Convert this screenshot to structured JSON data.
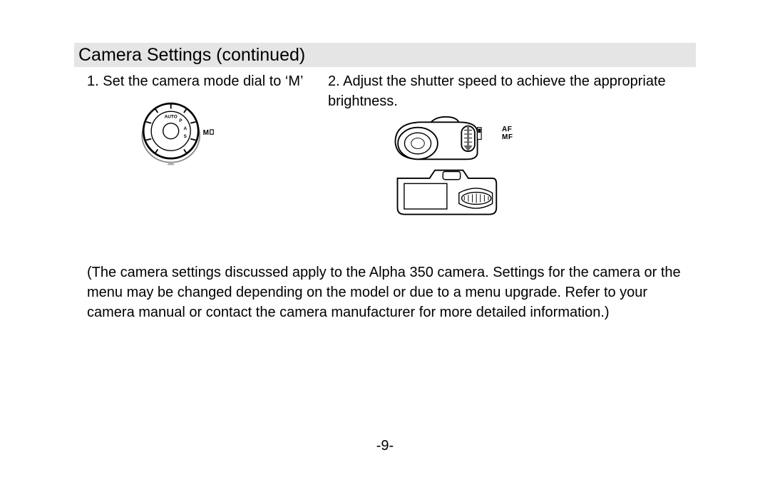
{
  "heading": "Camera Settings (continued)",
  "step1": {
    "text": "1. Set the camera mode dial to ‘M’"
  },
  "step2": {
    "text": "2. Adjust the shutter speed to achieve the appropriate brightness."
  },
  "af": "AF",
  "mf": "MF",
  "note": "(The camera settings discussed apply to the Alpha 350 camera. Settings for the camera or the menu may be changed depending on the model or due to a menu upgrade. Refer to your camera manual or contact the camera manufacturer for more detailed informa­tion.)",
  "page_number": "-9-"
}
